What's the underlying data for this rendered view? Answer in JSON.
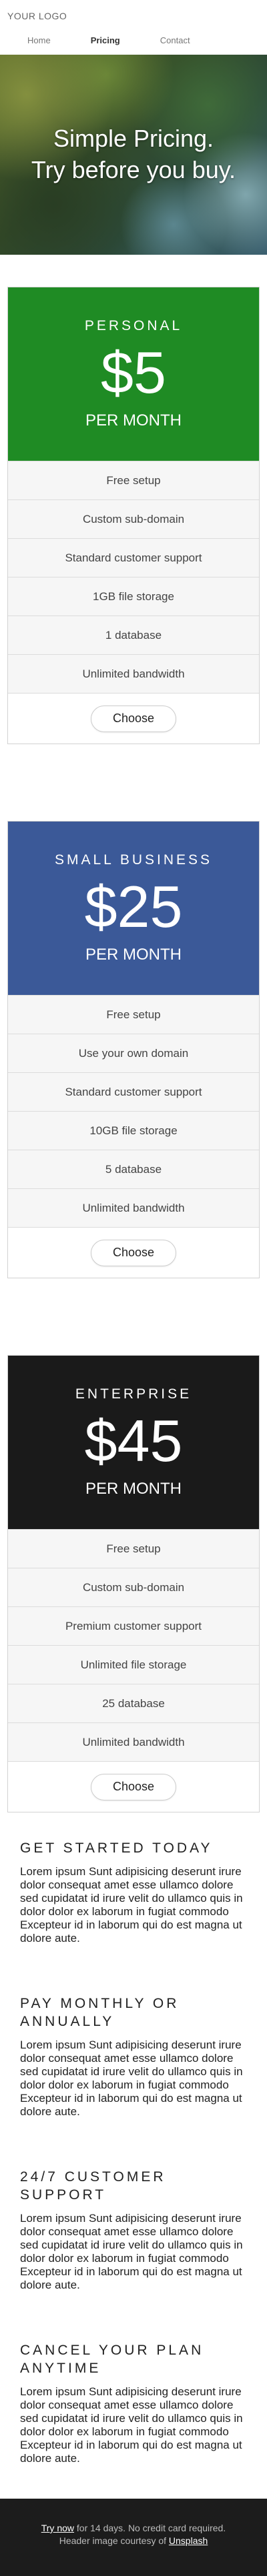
{
  "header": {
    "logo": "YOUR LOGO",
    "nav": [
      {
        "label": "Home",
        "active": false
      },
      {
        "label": "Pricing",
        "active": true
      },
      {
        "label": "Contact",
        "active": false
      }
    ]
  },
  "hero": {
    "line1": "Simple Pricing.",
    "line2": "Try before you buy."
  },
  "plans": [
    {
      "name": "PERSONAL",
      "price": "$5",
      "per": "PER MONTH",
      "color": "#1f8b24",
      "features": [
        "Free setup",
        "Custom sub-domain",
        "Standard customer support",
        "1GB file storage",
        "1 database",
        "Unlimited bandwidth"
      ],
      "button": "Choose"
    },
    {
      "name": "SMALL BUSINESS",
      "price": "$25",
      "per": "PER MONTH",
      "color": "#3b5998",
      "features": [
        "Free setup",
        "Use your own domain",
        "Standard customer support",
        "10GB file storage",
        "5 database",
        "Unlimited bandwidth"
      ],
      "button": "Choose"
    },
    {
      "name": "ENTERPRISE",
      "price": "$45",
      "per": "PER MONTH",
      "color": "#1a1a1a",
      "features": [
        "Free setup",
        "Custom sub-domain",
        "Premium customer support",
        "Unlimited file storage",
        "25 database",
        "Unlimited bandwidth"
      ],
      "button": "Choose"
    }
  ],
  "info": [
    {
      "title": "GET STARTED TODAY",
      "body": "Lorem ipsum Sunt adipisicing deserunt irure dolor consequat amet esse ullamco dolore sed cupidatat id irure velit do ullamco quis in dolor dolor ex laborum in fugiat commodo Excepteur id in laborum qui do est magna ut dolore aute."
    },
    {
      "title": "PAY MONTHLY OR ANNUALLY",
      "body": "Lorem ipsum Sunt adipisicing deserunt irure dolor consequat amet esse ullamco dolore sed cupidatat id irure velit do ullamco quis in dolor dolor ex laborum in fugiat commodo Excepteur id in laborum qui do est magna ut dolore aute."
    },
    {
      "title": "24/7 CUSTOMER SUPPORT",
      "body": "Lorem ipsum Sunt adipisicing deserunt irure dolor consequat amet esse ullamco dolore sed cupidatat id irure velit do ullamco quis in dolor dolor ex laborum in fugiat commodo Excepteur id in laborum qui do est magna ut dolore aute."
    },
    {
      "title": "CANCEL YOUR PLAN ANYTIME",
      "body": "Lorem ipsum Sunt adipisicing deserunt irure dolor consequat amet esse ullamco dolore sed cupidatat id irure velit do ullamco quis in dolor dolor ex laborum in fugiat commodo Excepteur id in laborum qui do est magna ut dolore aute."
    }
  ],
  "footer": {
    "try_link": "Try now",
    "try_rest": " for 14 days. No credit card required.",
    "credit_prefix": "Header image courtesy of ",
    "credit_link": "Unsplash"
  }
}
